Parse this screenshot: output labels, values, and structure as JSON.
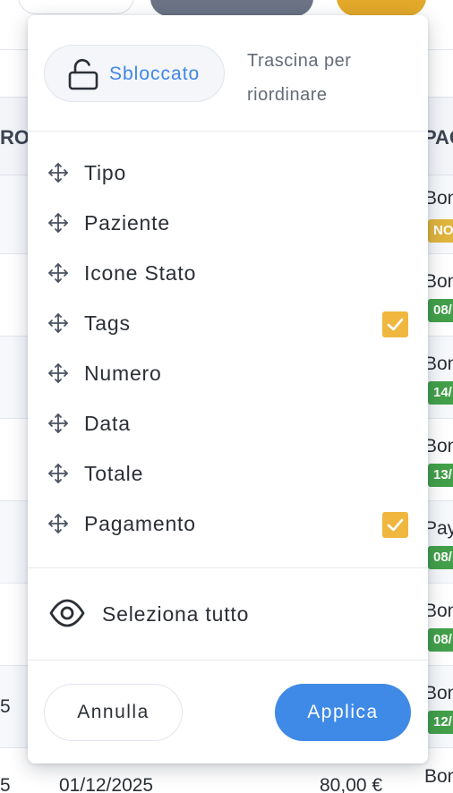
{
  "background": {
    "header_left_fragment": "RO",
    "header_right_fragment": "PAG",
    "rows": [
      {
        "name": "Bon",
        "tag": "NO",
        "tag_color": "#e0b43d"
      },
      {
        "name": "Bon",
        "tag": "08/",
        "tag_color": "#43a04a"
      },
      {
        "name": "Bon",
        "tag": "14/",
        "tag_color": "#43a04a"
      },
      {
        "name": "Bon",
        "tag": "13/",
        "tag_color": "#43a04a"
      },
      {
        "name": "Pay",
        "tag": "08/",
        "tag_color": "#43a04a"
      },
      {
        "name": "Bon",
        "tag": "08/",
        "tag_color": "#43a04a"
      },
      {
        "name": "Bon",
        "tag": "12/",
        "tag_color": "#43a04a",
        "left_fragment": "5"
      }
    ],
    "bottom_row": {
      "left_fragment": "5",
      "date": "01/12/2025",
      "amount": "80,00 €",
      "name": "Bon"
    }
  },
  "popover": {
    "lock": {
      "label": "Sbloccato",
      "icon": "unlock-icon"
    },
    "hint": "Trascina per riordinare",
    "columns": [
      {
        "label": "Tipo",
        "checked": false
      },
      {
        "label": "Paziente",
        "checked": false
      },
      {
        "label": "Icone Stato",
        "checked": false
      },
      {
        "label": "Tags",
        "checked": true
      },
      {
        "label": "Numero",
        "checked": false
      },
      {
        "label": "Data",
        "checked": false
      },
      {
        "label": "Totale",
        "checked": false
      },
      {
        "label": "Pagamento",
        "checked": true
      }
    ],
    "select_all_label": "Seleziona tutto",
    "cancel_label": "Annulla",
    "apply_label": "Applica"
  },
  "colors": {
    "accent_blue": "#3f8ae6",
    "checkbox_yellow": "#efb73e",
    "tag_green": "#43a04a",
    "tag_gold": "#e0b43d"
  }
}
